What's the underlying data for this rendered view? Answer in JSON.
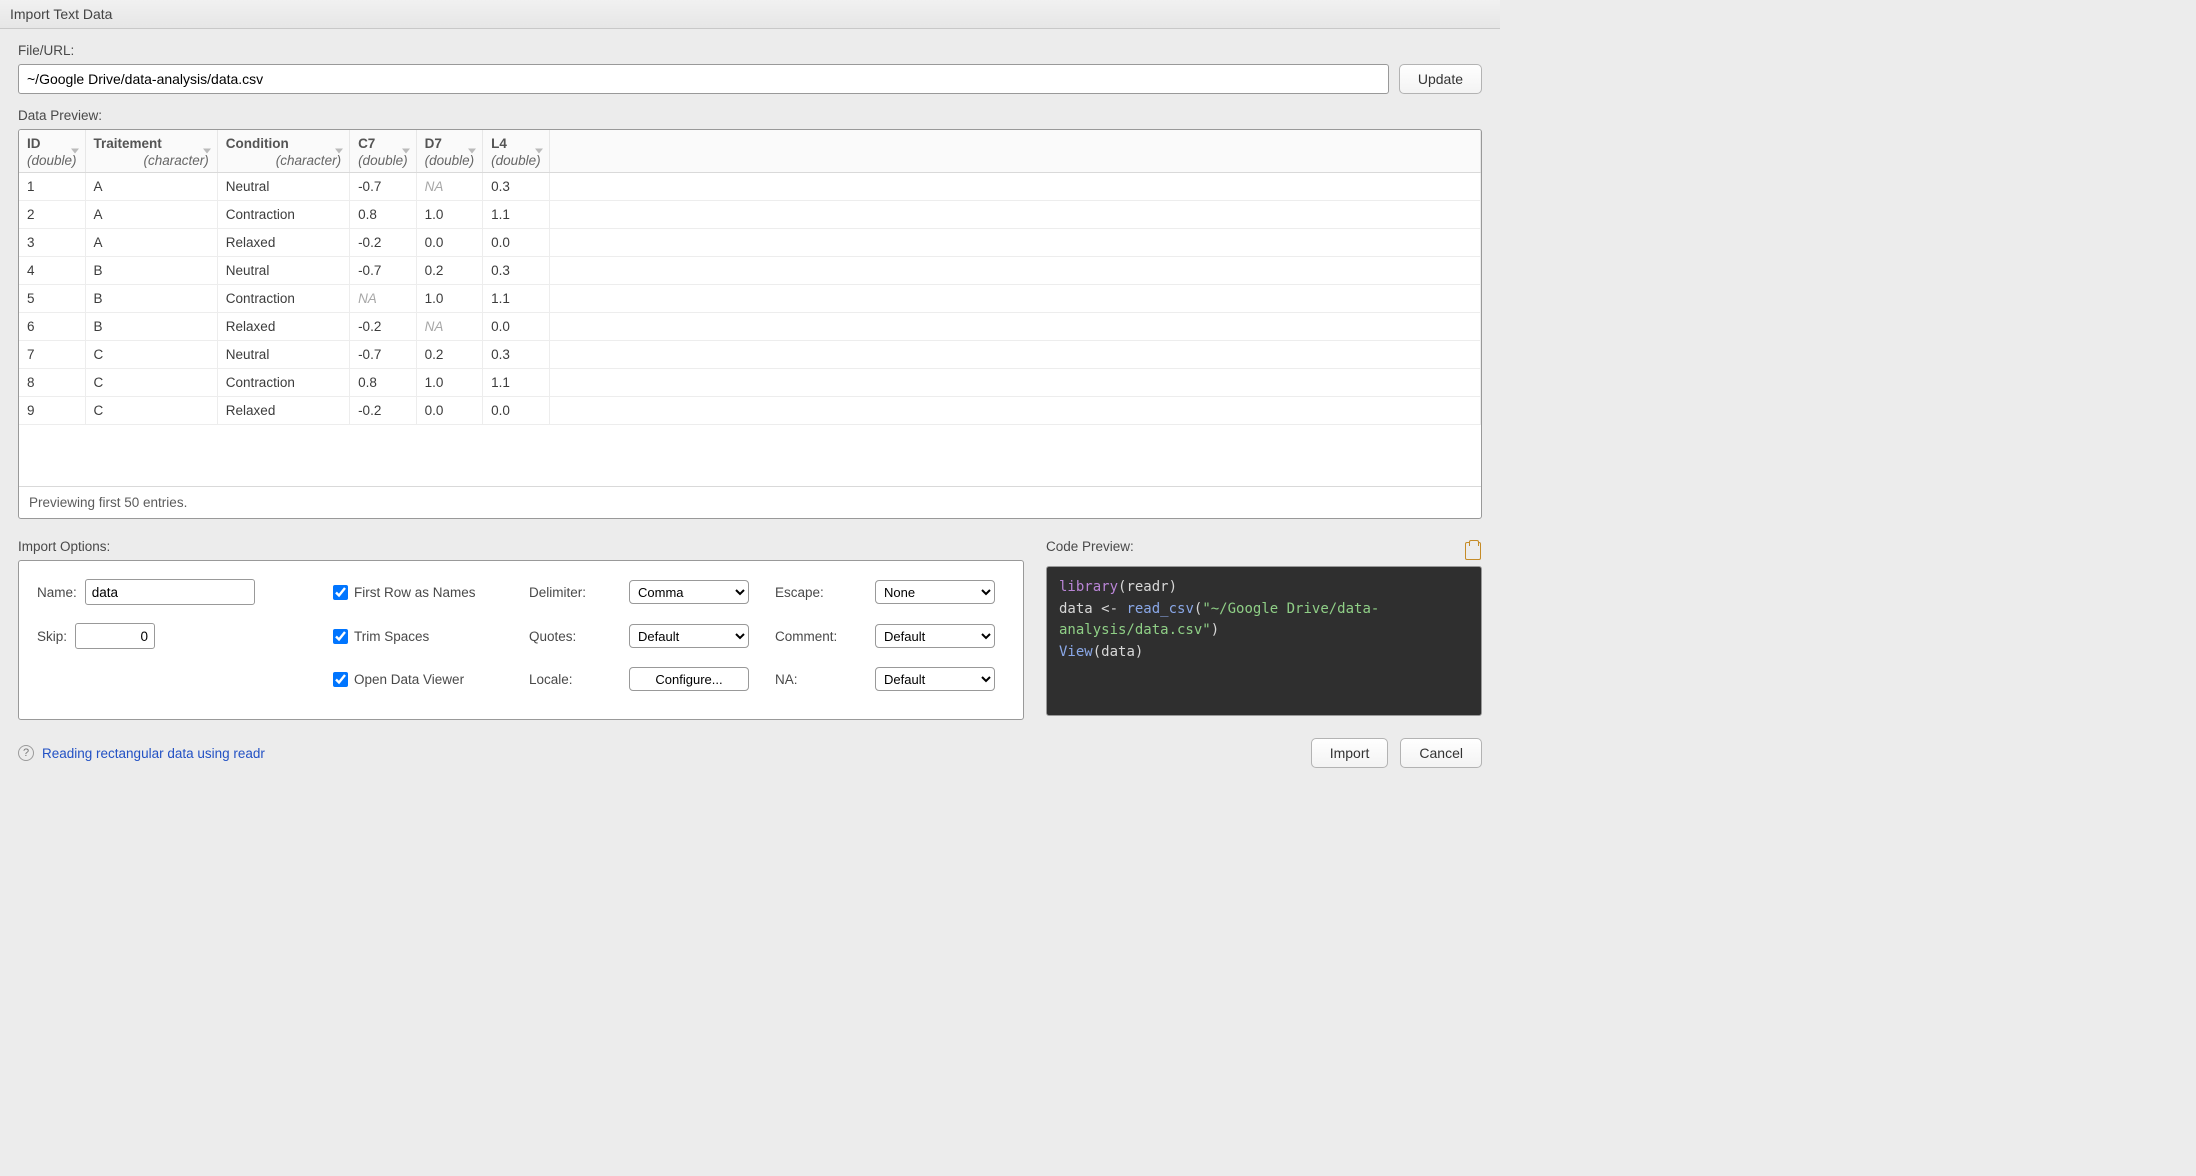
{
  "title": "Import Text Data",
  "fileurl": {
    "label": "File/URL:",
    "value": "~/Google Drive/data-analysis/data.csv",
    "update_label": "Update"
  },
  "preview": {
    "label": "Data Preview:",
    "columns": [
      {
        "name": "ID",
        "type": "(double)"
      },
      {
        "name": "Traitement",
        "type": "(character)"
      },
      {
        "name": "Condition",
        "type": "(character)"
      },
      {
        "name": "C7",
        "type": "(double)"
      },
      {
        "name": "D7",
        "type": "(double)"
      },
      {
        "name": "L4",
        "type": "(double)"
      }
    ],
    "rows": [
      [
        "1",
        "A",
        "Neutral",
        "-0.7",
        "NA",
        "0.3"
      ],
      [
        "2",
        "A",
        "Contraction",
        "0.8",
        "1.0",
        "1.1"
      ],
      [
        "3",
        "A",
        "Relaxed",
        "-0.2",
        "0.0",
        "0.0"
      ],
      [
        "4",
        "B",
        "Neutral",
        "-0.7",
        "0.2",
        "0.3"
      ],
      [
        "5",
        "B",
        "Contraction",
        "NA",
        "1.0",
        "1.1"
      ],
      [
        "6",
        "B",
        "Relaxed",
        "-0.2",
        "NA",
        "0.0"
      ],
      [
        "7",
        "C",
        "Neutral",
        "-0.7",
        "0.2",
        "0.3"
      ],
      [
        "8",
        "C",
        "Contraction",
        "0.8",
        "1.0",
        "1.1"
      ],
      [
        "9",
        "C",
        "Relaxed",
        "-0.2",
        "0.0",
        "0.0"
      ]
    ],
    "footer": "Previewing first 50 entries."
  },
  "options": {
    "heading": "Import Options:",
    "name_label": "Name:",
    "name_value": "data",
    "skip_label": "Skip:",
    "skip_value": "0",
    "first_row": "First Row as Names",
    "trim": "Trim Spaces",
    "open_viewer": "Open Data Viewer",
    "delimiter_label": "Delimiter:",
    "delimiter_value": "Comma",
    "quotes_label": "Quotes:",
    "quotes_value": "Default",
    "locale_label": "Locale:",
    "locale_button": "Configure...",
    "escape_label": "Escape:",
    "escape_value": "None",
    "comment_label": "Comment:",
    "comment_value": "Default",
    "na_label": "NA:",
    "na_value": "Default"
  },
  "code": {
    "heading": "Code Preview:",
    "tokens": {
      "library": "library",
      "readr": "readr",
      "assign_lhs": "data ",
      "assign_op": "<-",
      "read_csv": " read_csv",
      "path": "\"~/Google Drive/data-analysis/data.csv\"",
      "view": "View",
      "view_arg": "data"
    }
  },
  "help_link": "Reading rectangular data using readr",
  "buttons": {
    "import": "Import",
    "cancel": "Cancel"
  }
}
